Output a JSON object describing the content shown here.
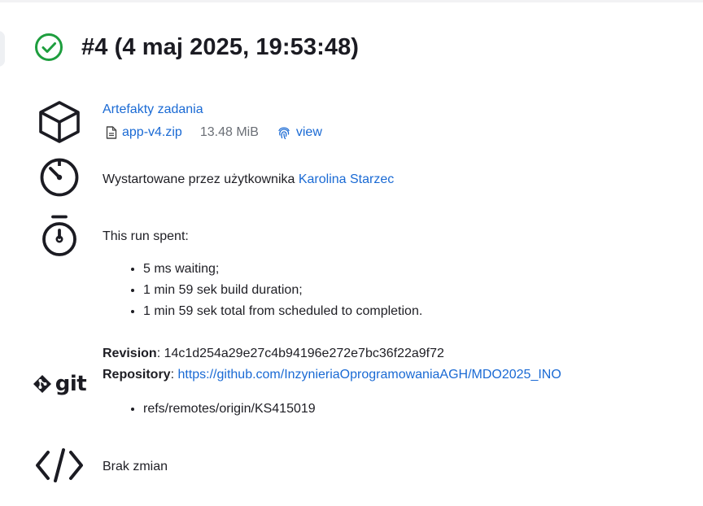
{
  "build": {
    "title": "#4 (4 maj 2025, 19:53:48)",
    "status_color": "#1e9e3e"
  },
  "artifacts": {
    "heading": "Artefakty zadania",
    "file_name": "app-v4.zip",
    "file_size": "13.48 MiB",
    "view_label": "view"
  },
  "started_by": {
    "prefix": "Wystartowane przez użytkownika ",
    "user": "Karolina Starzec"
  },
  "timing": {
    "heading": "This run spent:",
    "items": [
      "5 ms waiting;",
      "1 min 59 sek build duration;",
      "1 min 59 sek total from scheduled to completion."
    ]
  },
  "git": {
    "logo_text": "git",
    "revision_label": "Revision",
    "revision_value": ": 14c1d254a29e27c4b94196e272e7bc36f22a9f72",
    "repository_label": "Repository",
    "repository_sep": ": ",
    "repository_url": "https://github.com/InzynieriaOprogramowaniaAGH/MDO2025_INO",
    "refs": [
      "refs/remotes/origin/KS415019"
    ]
  },
  "changes": {
    "text": "Brak zmian"
  },
  "colors": {
    "link": "#1a6ad4",
    "text": "#1e1e24",
    "muted": "#6b6f76"
  }
}
